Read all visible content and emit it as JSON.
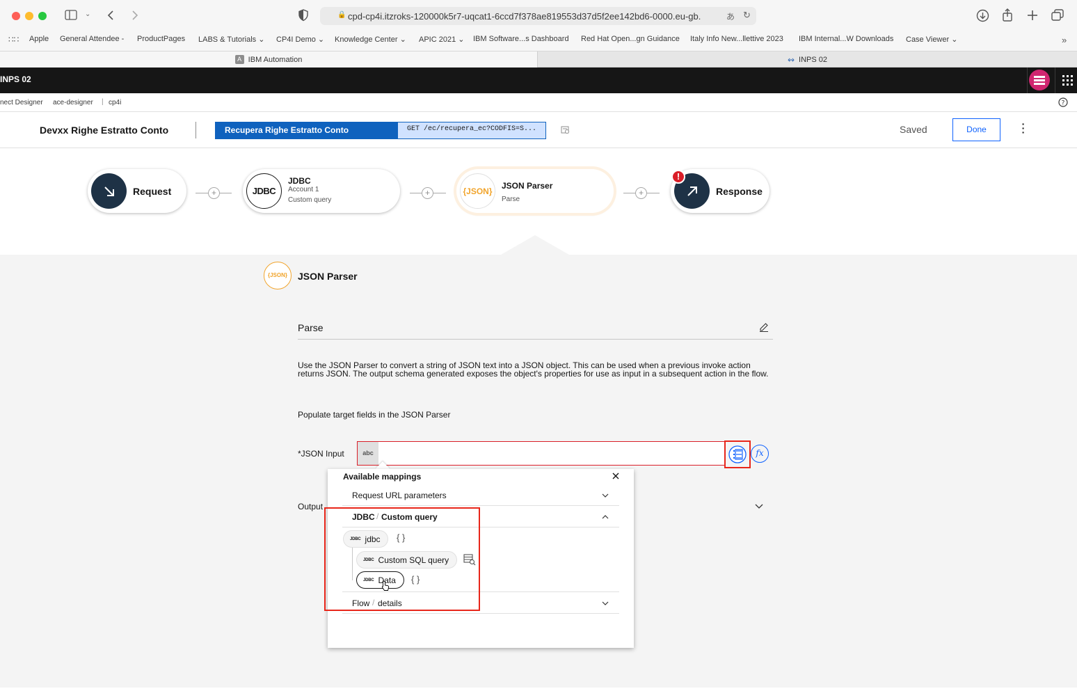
{
  "browser": {
    "url": "cpd-cp4i.itzroks-120000k5r7-uqcat1-6ccd7f378ae819553d37d5f2ee142bd6-0000.eu-gb.",
    "bookmarks": [
      "Apple",
      "General Attendee -",
      "ProductPages",
      "LABS & Tutorials",
      "CP4I Demo",
      "Knowledge Center",
      "APIC 2021",
      "IBM Software...s Dashboard",
      "Red Hat Open...gn Guidance",
      "Italy Info New...llettive 2023",
      "IBM Internal...W Downloads",
      "Case Viewer"
    ],
    "tabs": [
      {
        "label": "IBM Automation",
        "icon": "ibm-a-icon",
        "active": true
      },
      {
        "label": "INPS 02",
        "icon": "integration-icon",
        "active": false
      }
    ]
  },
  "app": {
    "header_title": "INPS 02",
    "breadcrumb": [
      "nect Designer",
      "ace-designer",
      "cp4i"
    ]
  },
  "flow": {
    "name": "Devxx Righe Estratto Conto",
    "operation_label": "Recupera Righe Estratto Conto",
    "operation_path": "GET /ec/recupera_ec?CODFIS=S...",
    "status": "Saved",
    "done_label": "Done"
  },
  "nodes": {
    "request": {
      "title": "Request"
    },
    "jdbc": {
      "icon_text": "JDBC",
      "title": "JDBC",
      "line1": "Account 1",
      "line2": "Custom query"
    },
    "json": {
      "icon_text": "{JSON}",
      "title": "JSON Parser",
      "line1": "Parse"
    },
    "response": {
      "title": "Response",
      "badge": "!"
    }
  },
  "panel": {
    "icon_text": "{JSON}",
    "title": "JSON Parser",
    "action": "Parse",
    "description": "Use the JSON Parser to convert a string of JSON text into a JSON object. This can be used when a previous invoke action returns JSON. The output schema generated exposes the object's properties for use as input in a subsequent action in the flow.",
    "populate": "Populate target fields in the JSON Parser",
    "json_input_label": "*JSON Input",
    "input_type": "abc",
    "output_label": "Output"
  },
  "mappings": {
    "title": "Available mappings",
    "request_section": "Request URL parameters",
    "jdbc_section_a": "JDBC",
    "jdbc_section_b": "Custom query",
    "jdbc_badge": "JDBC",
    "jdbc_item": "jdbc",
    "custom_sql": "Custom SQL query",
    "data_item": "Data",
    "braces": "{ }",
    "flow_section_a": "Flow",
    "flow_section_b": "details"
  },
  "colors": {
    "accent": "#0f62fe",
    "highlight": "#e8261a",
    "json_orange": "#f1a42b",
    "operation_blue": "#0f62be",
    "node_dark": "#1e3246"
  }
}
